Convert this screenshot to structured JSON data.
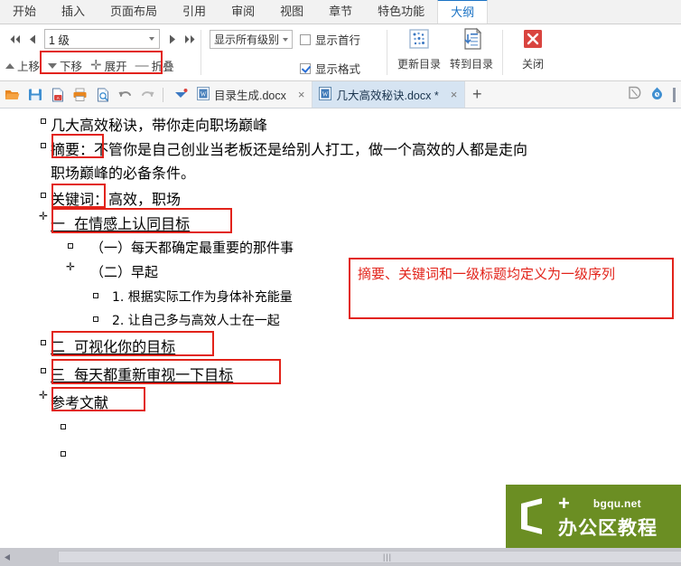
{
  "ribbon": {
    "tabs": [
      {
        "label": "开始",
        "active": false
      },
      {
        "label": "插入",
        "active": false
      },
      {
        "label": "页面布局",
        "active": false
      },
      {
        "label": "引用",
        "active": false
      },
      {
        "label": "审阅",
        "active": false
      },
      {
        "label": "视图",
        "active": false
      },
      {
        "label": "章节",
        "active": false
      },
      {
        "label": "特色功能",
        "active": false
      },
      {
        "label": "大纲",
        "active": true
      }
    ],
    "outline_group": {
      "level_value": "1 级",
      "promote_all": "提升至标题1",
      "promote": "提升",
      "demote": "降低",
      "demote_all": "降低至正文",
      "move_up": "上移",
      "move_down": "下移",
      "expand": "展开",
      "collapse": "折叠"
    },
    "display_group": {
      "show_level": "显示所有级别",
      "show_first_line": "显示首行",
      "show_first_line_checked": false,
      "show_format": "显示格式",
      "show_format_checked": true
    },
    "toc_group": {
      "update_toc": "更新目录",
      "goto_toc": "转到目录"
    },
    "close_group": {
      "close": "关闭"
    }
  },
  "quickbar": {
    "icons": [
      "open-icon",
      "save-icon",
      "export-pdf-icon",
      "print-icon",
      "print-preview-icon",
      "undo-icon",
      "redo-icon",
      "customize-icon"
    ],
    "tabs": [
      {
        "title": "目录生成.docx",
        "active": false,
        "modified": false
      },
      {
        "title": "几大高效秘诀.docx *",
        "active": true,
        "modified": true
      }
    ],
    "add_tab": "+",
    "right_icons": [
      "doc-tools-icon",
      "cloud-icon"
    ]
  },
  "outline": {
    "items": [
      {
        "marker": "square",
        "indent": 0,
        "text": "几大高效秘诀，带你走向职场巅峰",
        "size": 16,
        "boxed": false
      },
      {
        "marker": "square",
        "indent": 0,
        "text": "摘要：不管你是自己创业当老板还是给别人打工，做一个高效的人都是走向",
        "size": 16,
        "boxed": true
      },
      {
        "marker": "none",
        "indent": 0,
        "text": "职场巅峰的必备条件。",
        "size": 16,
        "boxed": false
      },
      {
        "marker": "square",
        "indent": 0,
        "text": "关键词：高效，职场",
        "size": 16,
        "boxed": true
      },
      {
        "marker": "cross",
        "indent": 0,
        "text": "一  在情感上认同目标",
        "size": 16,
        "boxed": true
      },
      {
        "marker": "square",
        "indent": 1,
        "text": "（一）每天都确定最重要的那件事",
        "size": 15,
        "boxed": false
      },
      {
        "marker": "cross",
        "indent": 1,
        "text": "（二）早起",
        "size": 15,
        "boxed": false
      },
      {
        "marker": "square",
        "indent": 2,
        "text": "1. 根据实际工作为身体补充能量",
        "size": 14,
        "boxed": false
      },
      {
        "marker": "square",
        "indent": 2,
        "text": "2. 让自己多与高效人士在一起",
        "size": 14,
        "boxed": false
      },
      {
        "marker": "square",
        "indent": 0,
        "text": "二  可视化你的目标",
        "size": 16,
        "boxed": true
      },
      {
        "marker": "square",
        "indent": 0,
        "text": "三  每天都重新审视一下目标",
        "size": 16,
        "boxed": true
      },
      {
        "marker": "cross",
        "indent": 0,
        "text": "参考文献",
        "size": 16,
        "boxed": true
      },
      {
        "marker": "square",
        "indent": 1,
        "text": "",
        "size": 14,
        "boxed": false
      },
      {
        "marker": "square",
        "indent": 1,
        "text": "",
        "size": 14,
        "boxed": false
      }
    ]
  },
  "annotation": {
    "text": "摘要、关键词和一级标题均定义为一级序列",
    "color": "#e2231a"
  },
  "watermark": {
    "plus": "+",
    "url": "bgqu.net",
    "name": "办公区教程",
    "bg": "#6b8e23"
  },
  "colors": {
    "accent": "#1a72c4",
    "annotation_red": "#e2231a",
    "ribbon_bg": "#f2f2f2",
    "active_tab_bg": "#d6e4f2"
  }
}
